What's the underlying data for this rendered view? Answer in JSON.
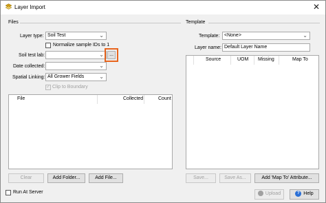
{
  "window": {
    "title": "Layer Import",
    "close_glyph": "✕"
  },
  "files": {
    "group_label": "Files",
    "layer_type": {
      "label": "Layer type:",
      "value": "Soil Test"
    },
    "normalize": {
      "label": "Normalize sample IDs to 1",
      "checked": false
    },
    "soil_test_lab": {
      "label": "Soil test lab:",
      "value": "",
      "browse_label": "..."
    },
    "date_collected": {
      "label": "Date collected:",
      "value": ""
    },
    "spatial_linking": {
      "label": "Spatial Linking:",
      "value": "All Grower Fields"
    },
    "clip_to_boundary": {
      "label": "Clip to Boundary",
      "checked": true,
      "disabled": true
    },
    "list_columns": [
      "File",
      "Collected",
      "Count"
    ],
    "buttons": {
      "clear": "Clear",
      "add_folder": "Add Folder...",
      "add_file": "Add File..."
    }
  },
  "template": {
    "group_label": "Template",
    "template_select": {
      "label": "Template:",
      "value": "<None>"
    },
    "layer_name": {
      "label": "Layer name:",
      "value": "Default Layer Name"
    },
    "list_columns": [
      "Source",
      "UOM",
      "Missing",
      "Map To"
    ],
    "buttons": {
      "save": "Save...",
      "save_as": "Save As...",
      "add_map_to": "Add 'Map To' Attribute..."
    }
  },
  "footer": {
    "run_at_server": {
      "label": "Run At Server",
      "checked": false
    },
    "upload_label": "Upload",
    "help_label": "Help"
  },
  "icons": {
    "app": "layer-import-icon",
    "upload": "upload-icon",
    "help": "help-icon"
  },
  "colors": {
    "highlight": "#e8641c",
    "help_blue": "#2a6fd6"
  }
}
